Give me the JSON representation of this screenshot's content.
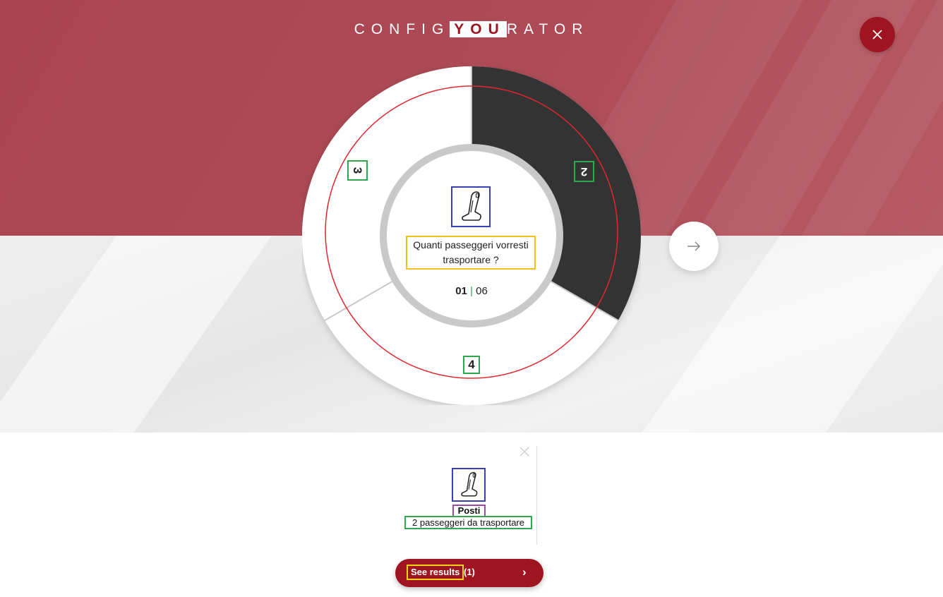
{
  "header": {
    "brand_prefix": "CONFIG",
    "brand_highlight": "YOU",
    "brand_suffix": "RATOR",
    "close_icon": "close-icon"
  },
  "wheel": {
    "options": [
      "2",
      "4",
      "3"
    ],
    "selected": "2",
    "question": "Quanti passeggeri vorresti trasportare ?",
    "step_current": "01",
    "step_separator": "|",
    "step_total": "06",
    "center_icon": "car-seat-icon",
    "colors": {
      "selected": "#333333",
      "unselected": "#ffffff",
      "accent_ring": "#e0272e"
    }
  },
  "navigation": {
    "next_icon": "arrow-right-icon"
  },
  "summary": {
    "icon": "car-seat-icon",
    "title": "Posti",
    "value": "2 passeggeri da trasportare",
    "remove_icon": "close-icon"
  },
  "results": {
    "label": "See results",
    "count": "(1)",
    "chevron": "›",
    "color": "#9e1420"
  }
}
